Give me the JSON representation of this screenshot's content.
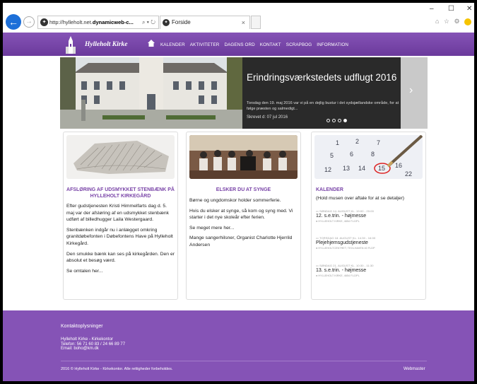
{
  "browser": {
    "address_prefix": "http://hylleholt.net.",
    "address_host": "dynamicweb-c...",
    "address_tools": "⌕ ▾ ↻",
    "tab_title": "Forside",
    "tab_close": "×",
    "win_min": "–",
    "win_max": "☐",
    "win_close": "✕",
    "right_icons": "⌂ ☆ ⚙"
  },
  "site": {
    "logo_text": "Hylleholt Kirke",
    "menu": [
      "KALENDER",
      "AKTIVITETER",
      "DAGENS ORD",
      "KONTAKT",
      "SCRAPBOG",
      "INFORMATION"
    ]
  },
  "hero": {
    "title": "Erindringsværkstedets udflugt 2016",
    "description": "Torsdag den 19. maj 2016 var vi på en dejlig bustur i det sydsjællandske område, for at følge præsten og salmedigt...",
    "date": "Skrevet d: 07 jul 2016",
    "next_arrow": "›",
    "slide_count": 4,
    "active_slide": 4
  },
  "cards": [
    {
      "title": "AFSLØRING AF UDSMYKKET STENBÆNK PÅ HYLLEHOLT KIRKEGÅRD",
      "paragraphs": [
        "Efter gudstjenesten Kristi Himmelfarts dag d. 5. maj var der afsløring af en udsmykket stenbænk udført af billedhugger Laila Westergaard.",
        "Stenbænken indgår nu i anlægget omkring granitdøbefonten i Døbefontens Have på Hylleholt Kirkegård.",
        "Den smukke bænk kan ses på kirkegården. Den er absolut et besøg værd.",
        "Se omtalen her..."
      ]
    },
    {
      "title": "ELSKER DU AT SYNGE",
      "paragraphs": [
        "Børne og ungdomskor holder sommerferie.",
        "Hvis du elsker at synge, så kom og syng med. Vi starter i det nye skoleår efter ferien.",
        "Se meget mere her...",
        "Mange sangerhilsner, Organist Charlotte Hjerrild Andersen"
      ]
    }
  ],
  "calendar": {
    "title": "KALENDER",
    "subtitle": "(Hold musen over aftale for at se detaljer)",
    "events": [
      {
        "date": "SØNDAG 14. AUGUST KL. 19:00 - 20:00",
        "title": "12. s.e.trin. - højmesse",
        "place": "HYLLEHOLT KIRKE, 4654 F.LDPL"
      },
      {
        "date": "TORSDAG 18. AUGUST KL. 14:30 - 16:00",
        "title": "Plejehjemsgudstjeneste",
        "place": "HYLLEHOLTCENTRET, TEGLHAVEN 40 FLDP"
      },
      {
        "date": "SØNDAG 21. AUGUST KL. 10:30 - 11:30",
        "title": "13. s.e.trin. - højmesse",
        "place": "HYLLEHOLT KIRKE, 4654 F.LDPL"
      }
    ]
  },
  "footer": {
    "heading": "Kontaktoplysninger",
    "lines": [
      "Hylleholt Kirke - Kirkekontor",
      "Telefon: 56 71 60 83 / 24 66 89 77",
      "Email: boho@km.dk"
    ],
    "copyright": "2016 © Hylleholt Kirke - Kirkekontor. Alle rettigheder forbeholdes.",
    "webmaster": "Webmaster"
  },
  "colors": {
    "brand_purple": "#8553b6",
    "title_purple": "#7a45a8",
    "browser_back": "#1d6fd8"
  }
}
